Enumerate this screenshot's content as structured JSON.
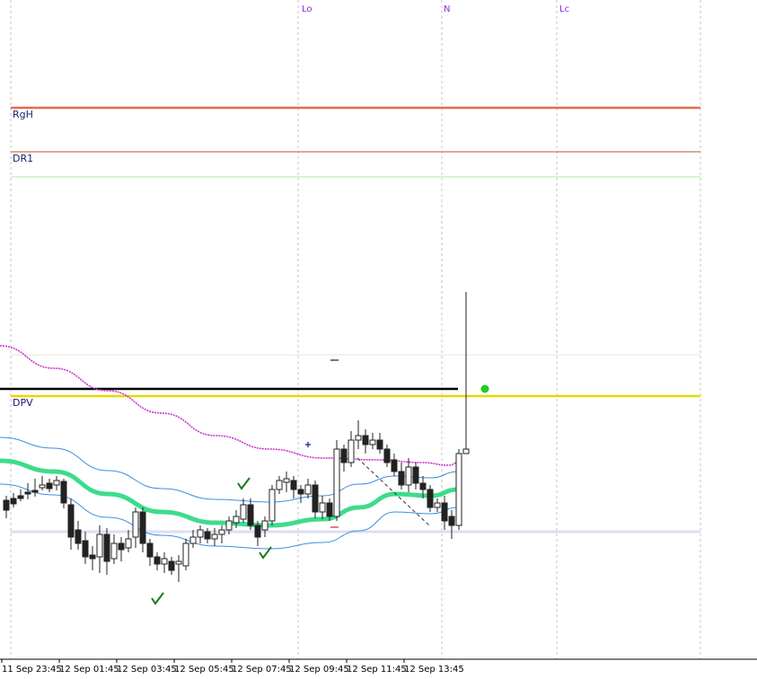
{
  "chart_data": {
    "type": "candlestick",
    "title": "",
    "xlabel": "",
    "ylabel": "",
    "grid": true,
    "ylim": [
      0,
      752
    ],
    "x_tick_labels": [
      "11 Sep 23:45",
      "12 Sep 01:45",
      "12 Sep 03:45",
      "12 Sep 05:45",
      "12 Sep 07:45",
      "12 Sep 09:45",
      "12 Sep 11:45",
      "12 Sep 13:45"
    ],
    "session_labels": [
      "Lo",
      "N",
      "Lc"
    ],
    "levels": [
      {
        "label": "RgH",
        "value": 120,
        "color": "#e8694b"
      },
      {
        "label": "DR1",
        "value": 169,
        "color": "#c8785a"
      },
      {
        "label": "",
        "value": 197,
        "color": "#b8efb8"
      },
      {
        "label": "",
        "value": 395,
        "color": "#ecebd9"
      },
      {
        "label": "",
        "value": 433,
        "color": "#000000"
      },
      {
        "label": "DPV",
        "value": 441,
        "color": "#e6d800"
      },
      {
        "label": "",
        "value": 592,
        "color": "#dcdcf4"
      }
    ],
    "candles": [
      [
        557,
        568,
        552,
        577
      ],
      [
        555,
        561,
        549,
        565
      ],
      [
        552,
        555,
        545,
        558
      ],
      [
        548,
        550,
        538,
        556
      ],
      [
        546,
        548,
        533,
        553
      ],
      [
        543,
        540,
        530,
        546
      ],
      [
        538,
        544,
        533,
        548
      ],
      [
        540,
        535,
        530,
        546
      ],
      [
        536,
        560,
        533,
        566
      ],
      [
        562,
        598,
        555,
        612
      ],
      [
        590,
        605,
        580,
        612
      ],
      [
        602,
        620,
        592,
        628
      ],
      [
        618,
        622,
        608,
        635
      ],
      [
        620,
        595,
        585,
        638
      ],
      [
        595,
        625,
        588,
        640
      ],
      [
        622,
        605,
        595,
        628
      ],
      [
        605,
        612,
        598,
        625
      ],
      [
        610,
        600,
        590,
        615
      ],
      [
        598,
        570,
        565,
        610
      ],
      [
        570,
        605,
        565,
        615
      ],
      [
        605,
        620,
        600,
        630
      ],
      [
        620,
        628,
        615,
        635
      ],
      [
        628,
        622,
        615,
        638
      ],
      [
        625,
        635,
        620,
        640
      ],
      [
        628,
        625,
        618,
        648
      ],
      [
        630,
        605,
        600,
        635
      ],
      [
        605,
        598,
        590,
        610
      ],
      [
        598,
        590,
        585,
        605
      ],
      [
        592,
        600,
        588,
        605
      ],
      [
        600,
        595,
        588,
        608
      ],
      [
        595,
        590,
        585,
        605
      ],
      [
        590,
        580,
        575,
        595
      ],
      [
        582,
        575,
        568,
        588
      ],
      [
        578,
        562,
        555,
        582
      ],
      [
        562,
        585,
        555,
        590
      ],
      [
        585,
        598,
        580,
        608
      ],
      [
        590,
        580,
        575,
        598
      ],
      [
        580,
        545,
        540,
        585
      ],
      [
        545,
        535,
        530,
        550
      ],
      [
        537,
        533,
        525,
        548
      ],
      [
        535,
        545,
        530,
        555
      ],
      [
        545,
        550,
        540,
        560
      ],
      [
        550,
        540,
        533,
        555
      ],
      [
        540,
        570,
        535,
        577
      ],
      [
        570,
        560,
        552,
        578
      ],
      [
        560,
        575,
        555,
        580
      ],
      [
        575,
        500,
        490,
        580
      ],
      [
        500,
        515,
        495,
        525
      ],
      [
        515,
        490,
        480,
        520
      ],
      [
        490,
        485,
        468,
        500
      ],
      [
        485,
        495,
        478,
        505
      ],
      [
        495,
        490,
        482,
        500
      ],
      [
        490,
        500,
        482,
        505
      ],
      [
        500,
        515,
        495,
        520
      ],
      [
        512,
        525,
        505,
        530
      ],
      [
        525,
        540,
        515,
        545
      ],
      [
        540,
        520,
        510,
        548
      ],
      [
        520,
        538,
        515,
        545
      ],
      [
        538,
        545,
        530,
        555
      ],
      [
        545,
        565,
        540,
        570
      ],
      [
        565,
        560,
        555,
        570
      ],
      [
        560,
        580,
        552,
        590
      ],
      [
        575,
        585,
        568,
        600
      ],
      [
        585,
        505,
        500,
        590
      ],
      [
        505,
        500,
        325,
        503
      ]
    ],
    "markers": [
      {
        "type": "check",
        "slot": 21,
        "y": 668,
        "color": "#1a7a1a"
      },
      {
        "type": "check",
        "slot": 33,
        "y": 540,
        "color": "#1a7a1a"
      },
      {
        "type": "check",
        "slot": 36,
        "y": 617,
        "color": "#1a7a1a"
      },
      {
        "type": "cross",
        "slot": 42,
        "y": 495,
        "color": "#3040b0"
      }
    ]
  }
}
